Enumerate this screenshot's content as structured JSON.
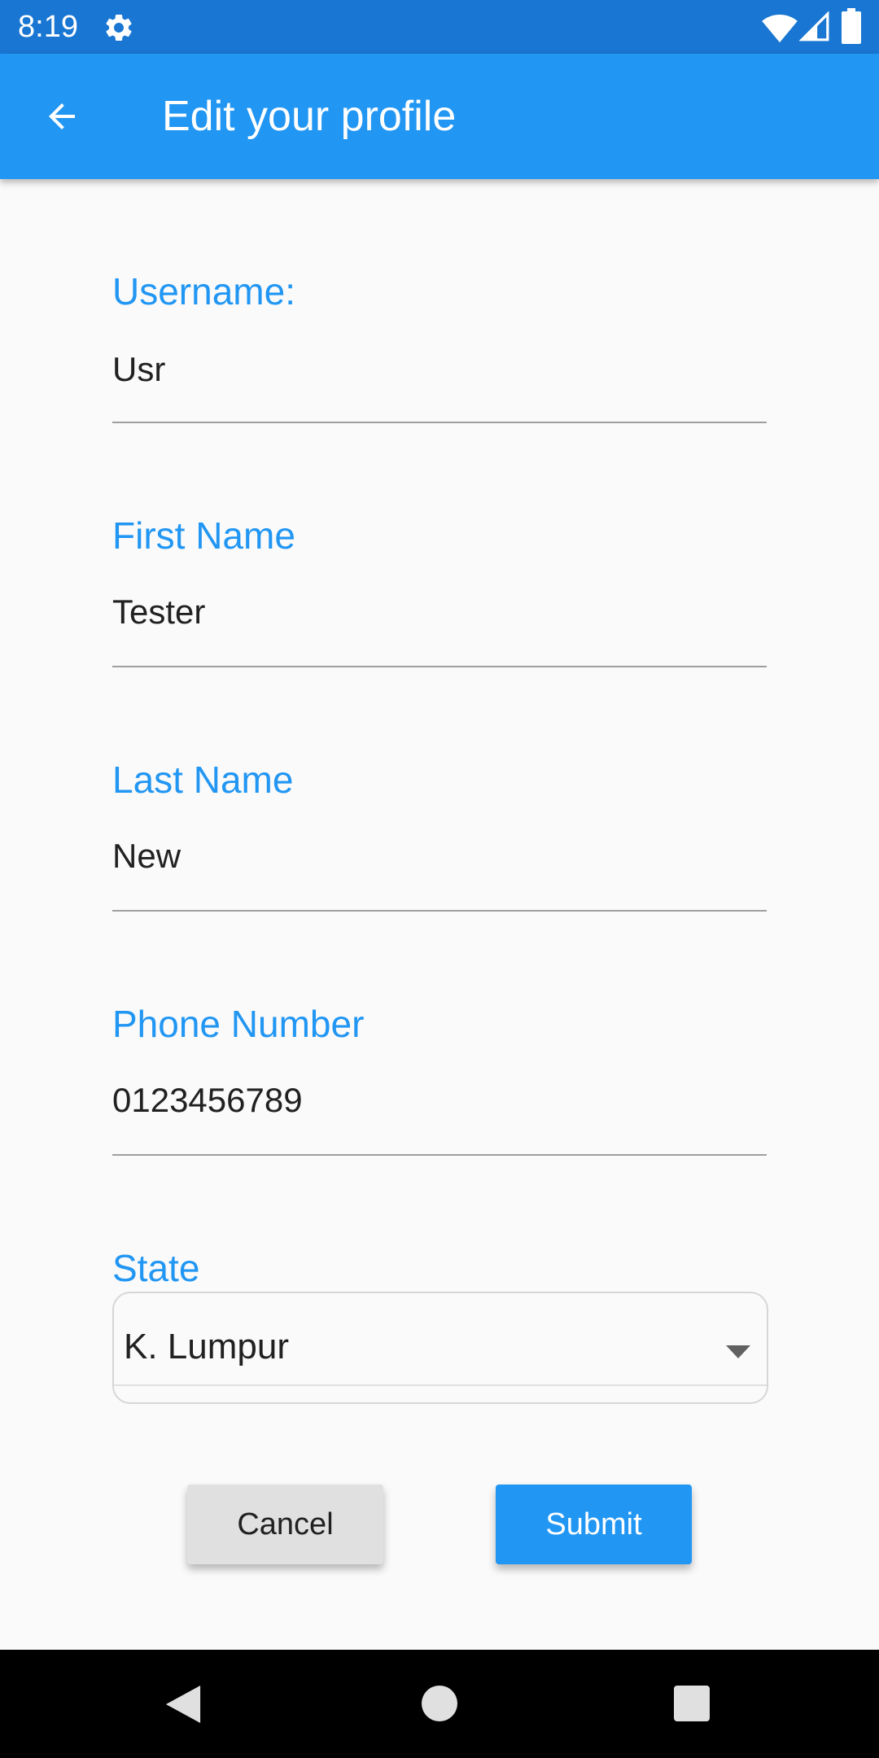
{
  "status_bar": {
    "time": "8:19",
    "icons": [
      "gear-icon",
      "wifi-icon",
      "signal-icon",
      "battery-icon"
    ]
  },
  "app_bar": {
    "title": "Edit your profile",
    "back_icon": "arrow-back-icon",
    "background_color": "#2196f3",
    "status_color": "#1976d2"
  },
  "form": {
    "username": {
      "label": "Username:",
      "value": "Usr"
    },
    "first_name": {
      "label": "First Name",
      "value": "Tester"
    },
    "last_name": {
      "label": "Last Name",
      "value": "New"
    },
    "phone_number": {
      "label": "Phone Number",
      "value": "0123456789"
    },
    "state": {
      "label": "State",
      "selected": "K. Lumpur",
      "icon": "dropdown-arrow-icon"
    },
    "label_color": "#2196f3"
  },
  "buttons": {
    "cancel_label": "Cancel",
    "submit_label": "Submit"
  },
  "nav_bar": {
    "icons": [
      "nav-back-icon",
      "nav-home-icon",
      "nav-recents-icon"
    ]
  }
}
